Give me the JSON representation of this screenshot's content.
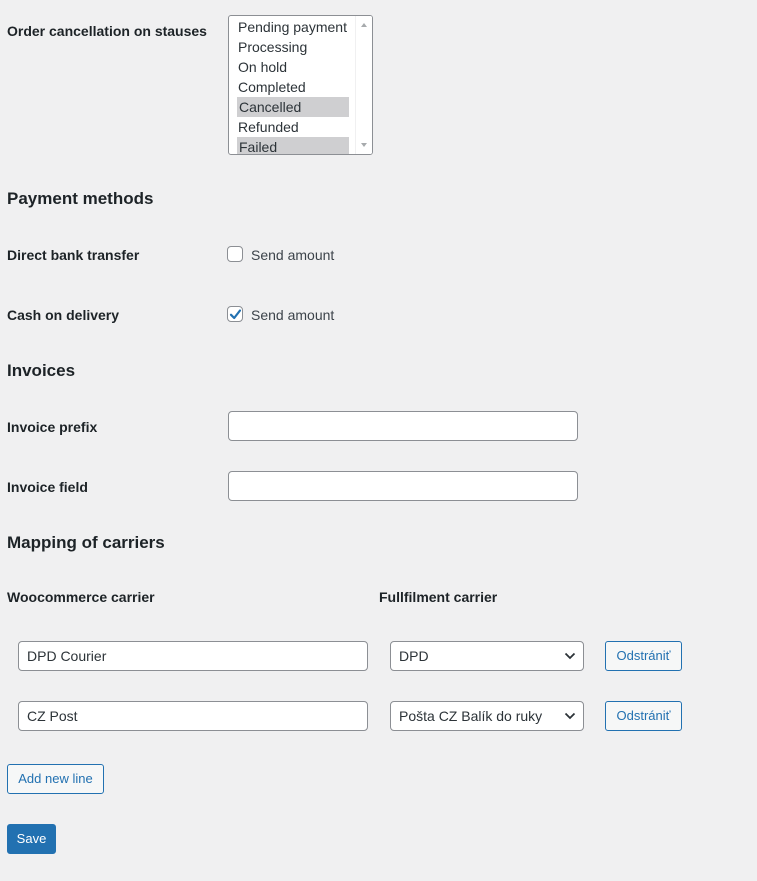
{
  "order_cancellation": {
    "label": "Order cancellation on stauses",
    "options": [
      {
        "label": "Pending payment",
        "selected": false
      },
      {
        "label": "Processing",
        "selected": false
      },
      {
        "label": "On hold",
        "selected": false
      },
      {
        "label": "Completed",
        "selected": false
      },
      {
        "label": "Cancelled",
        "selected": true
      },
      {
        "label": "Refunded",
        "selected": false
      },
      {
        "label": "Failed",
        "selected": true
      }
    ]
  },
  "payment_methods": {
    "heading": "Payment methods",
    "direct_bank": {
      "label": "Direct bank transfer",
      "checkbox_label": "Send amount",
      "checked": false
    },
    "cash_on_delivery": {
      "label": "Cash on delivery",
      "checkbox_label": "Send amount",
      "checked": true
    }
  },
  "invoices": {
    "heading": "Invoices",
    "prefix": {
      "label": "Invoice prefix",
      "value": "",
      "placeholder": ""
    },
    "field": {
      "label": "Invoice field",
      "value": "",
      "placeholder": ""
    }
  },
  "carriers": {
    "heading": "Mapping of carriers",
    "col_woo": "Woocommerce carrier",
    "col_fulfilment": "Fullfilment carrier",
    "rows": [
      {
        "woo": "DPD Courier",
        "fulfilment": "DPD",
        "remove_label": "Odstrániť"
      },
      {
        "woo": "CZ Post",
        "fulfilment": "Pošta CZ Balík do ruky",
        "remove_label": "Odstrániť"
      }
    ],
    "add_label": "Add new line"
  },
  "save_label": "Save",
  "colors": {
    "accent": "#2271b1",
    "background": "#f0f0f1",
    "selected_option": "#cfcfd1"
  },
  "icons": {
    "checkmark": "check-icon",
    "dropdown": "chevron-down-icon"
  }
}
